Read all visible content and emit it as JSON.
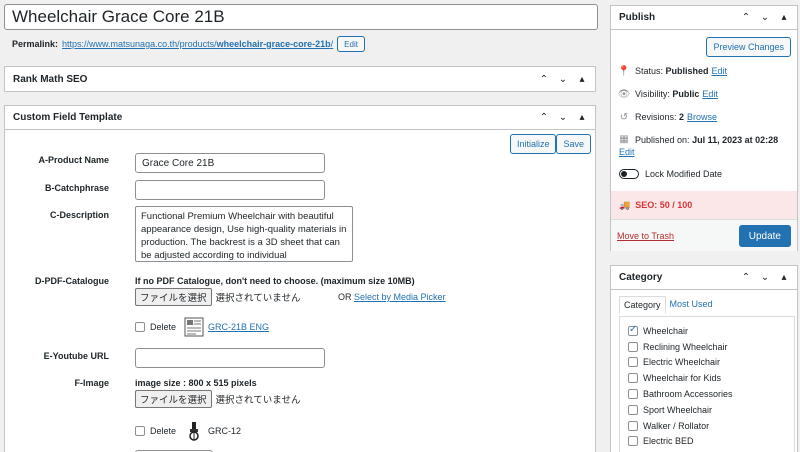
{
  "post": {
    "title": "Wheelchair Grace Core 21B",
    "permalink_label": "Permalink:",
    "permalink_url": "https://www.matsunaga.co.th/products/",
    "permalink_slug": "wheelchair-grace-core-21b",
    "permalink_tail": "/",
    "edit_label": "Edit"
  },
  "rank_math": {
    "title": "Rank Math SEO"
  },
  "cft": {
    "title": "Custom Field Template",
    "initialize_label": "Initialize",
    "save_label": "Save",
    "fields": {
      "product_name": {
        "label": "A-Product Name",
        "value": "Grace Core 21B"
      },
      "catchphrase": {
        "label": "B-Catchphrase",
        "value": ""
      },
      "description": {
        "label": "C-Description",
        "value": "Functional Premium Wheelchair with beautiful appearance design, Use high-quality materials in production. The backrest is a 3D sheet that can be adjusted according to individual"
      },
      "pdf_catalogue": {
        "label": "D-PDF-Catalogue",
        "note": "If no PDF Catalogue, don't need to choose. (maximum size 10MB)",
        "choose_label": "ファイルを選択",
        "no_file_text": "選択されていません",
        "or_text": "OR",
        "media_picker_label": "Select by Media Picker",
        "delete_label": "Delete",
        "file_name": "GRC-21B ENG"
      },
      "youtube_url": {
        "label": "E-Youtube URL",
        "value": ""
      },
      "image": {
        "label": "F-Image",
        "note": "image size : 800 x 515 pixels",
        "choose_label": "ファイルを選択",
        "no_file_text": "選択されていません",
        "delete_label": "Delete",
        "file_name": "GRC-12"
      }
    }
  },
  "publish": {
    "title": "Publish",
    "preview_label": "Preview Changes",
    "status_label": "Status:",
    "status_value": "Published",
    "visibility_label": "Visibility:",
    "visibility_value": "Public",
    "revisions_label": "Revisions:",
    "revisions_value": "2",
    "browse_label": "Browse",
    "published_on_label": "Published on:",
    "published_on_value": "Jul 11, 2023 at 02:28",
    "edit_label": "Edit",
    "lock_label": "Lock Modified Date",
    "seo_text": "SEO: 50 / 100",
    "trash_label": "Move to Trash",
    "update_label": "Update"
  },
  "category": {
    "title": "Category",
    "tab_all": "Category",
    "tab_most_used": "Most Used",
    "items": [
      {
        "label": "Wheelchair",
        "checked": true
      },
      {
        "label": "Reclining Wheelchair",
        "checked": false
      },
      {
        "label": "Electric Wheelchair",
        "checked": false
      },
      {
        "label": "Wheelchair for Kids",
        "checked": false
      },
      {
        "label": "Bathroom Accessories",
        "checked": false
      },
      {
        "label": "Sport Wheelchair",
        "checked": false
      },
      {
        "label": "Walker / Rollator",
        "checked": false
      },
      {
        "label": "Electric BED",
        "checked": false
      }
    ]
  },
  "colors": {
    "accent": "#2271b1",
    "seo_bad": "#d63638",
    "trash": "#b32d2e"
  }
}
